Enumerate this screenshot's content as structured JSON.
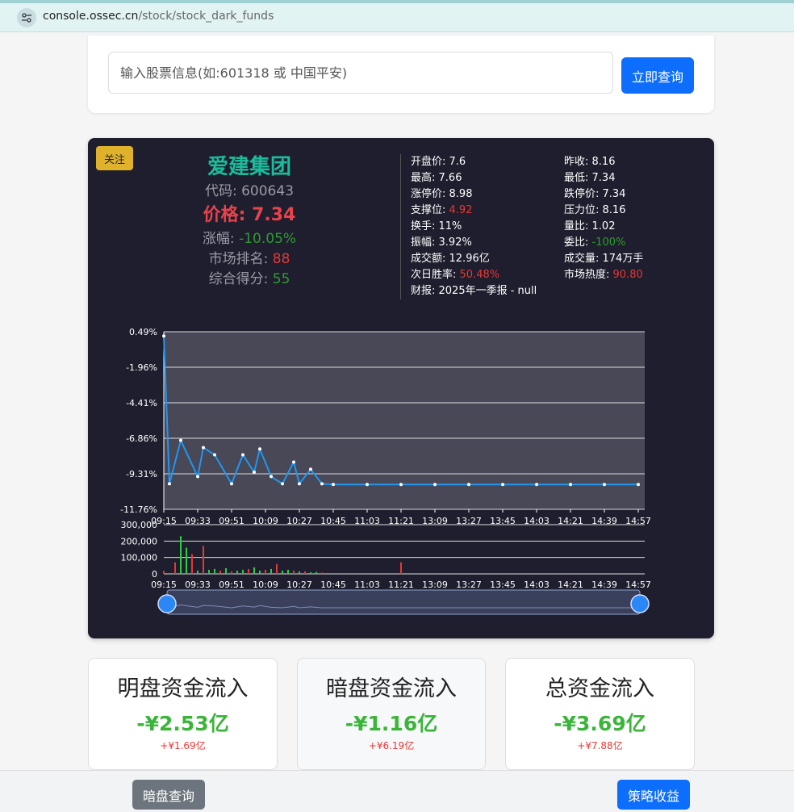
{
  "browser": {
    "url_host": "console.ossec.cn",
    "url_path": "/stock/stock_dark_funds"
  },
  "search": {
    "placeholder": "输入股票信息(如:601318 或 中国平安)",
    "button_label": "立即查询"
  },
  "stock": {
    "follow_label": "关注",
    "name": "爱建集团",
    "code_label": "代码: ",
    "code": "600643",
    "price_label": "价格: ",
    "price": "7.34",
    "change_label": "涨幅: ",
    "change": "-10.05%",
    "rank_label": "市场排名: ",
    "rank": "88",
    "score_label": "综合得分: ",
    "score": "55"
  },
  "stats": {
    "open_label": "开盘价: ",
    "open": "7.6",
    "prev_close_label": "昨收: ",
    "prev_close": "8.16",
    "high_label": "最高: ",
    "high": "7.66",
    "low_label": "最低: ",
    "low": "7.34",
    "limit_up_label": "涨停价: ",
    "limit_up": "8.98",
    "limit_down_label": "跌停价: ",
    "limit_down": "7.34",
    "support_label": "支撑位: ",
    "support": "4.92",
    "resistance_label": "压力位: ",
    "resistance": "8.16",
    "turnover_label": "换手: ",
    "turnover": "11%",
    "volume_ratio_label": "量比: ",
    "volume_ratio": "1.02",
    "amplitude_label": "振幅: ",
    "amplitude": "3.92%",
    "bid_ratio_label": "委比: ",
    "bid_ratio": "-100%",
    "amount_label": "成交额: ",
    "amount": "12.96亿",
    "volume_label": "成交量: ",
    "volume": "174万手",
    "win_rate_label": "次日胜率: ",
    "win_rate": "50.48%",
    "heat_label": "市场热度: ",
    "heat": "90.80",
    "report_label": "财报: ",
    "report": "2025年一季报 - null"
  },
  "chart_data": [
    {
      "type": "line",
      "series": [
        {
          "values": [
            0.2,
            -10.0,
            -7.0,
            -9.5,
            -7.5,
            -8.0,
            -10.0,
            -8.0,
            -9.2,
            -7.6,
            -9.5,
            -10.0,
            -8.5,
            -10.0,
            -9.0,
            -10.0,
            -10.05,
            -10.05,
            -10.05,
            -10.05,
            -10.05,
            -10.05,
            -10.05,
            -10.05,
            -10.05,
            -10.05
          ]
        }
      ],
      "x": [
        "09:15",
        "09:18",
        "09:24",
        "09:33",
        "09:36",
        "09:42",
        "09:51",
        "09:57",
        "10:03",
        "10:06",
        "10:12",
        "10:18",
        "10:24",
        "10:27",
        "10:33",
        "10:39",
        "10:45",
        "11:03",
        "11:21",
        "13:09",
        "13:27",
        "13:45",
        "14:03",
        "14:21",
        "14:39",
        "14:57"
      ],
      "xticks": [
        "09:15",
        "09:33",
        "09:51",
        "10:09",
        "10:27",
        "10:45",
        "11:03",
        "11:21",
        "13:09",
        "13:27",
        "13:45",
        "14:03",
        "14:21",
        "14:39",
        "14:57"
      ],
      "yticks": [
        "0.49%",
        "-1.96%",
        "-4.41%",
        "-6.86%",
        "-9.31%",
        "-11.76%"
      ],
      "ylim": [
        -11.76,
        0.49
      ],
      "grid": true,
      "color": "#2196f3"
    },
    {
      "type": "bar",
      "x": [
        "09:15",
        "09:21",
        "09:24",
        "09:27",
        "09:30",
        "09:33",
        "09:36",
        "09:39",
        "09:42",
        "09:45",
        "09:48",
        "09:51",
        "09:54",
        "09:57",
        "10:00",
        "10:03",
        "10:06",
        "10:09",
        "10:12",
        "10:15",
        "10:18",
        "10:21",
        "10:24",
        "10:27",
        "10:30",
        "10:33",
        "10:36",
        "10:39",
        "11:21"
      ],
      "values": [
        18000,
        70000,
        230000,
        160000,
        120000,
        20000,
        170000,
        25000,
        30000,
        20000,
        35000,
        15000,
        20000,
        25000,
        30000,
        40000,
        20000,
        25000,
        30000,
        60000,
        20000,
        25000,
        20000,
        15000,
        15000,
        10000,
        12000,
        8000,
        70000
      ],
      "colors": [
        "red",
        "red",
        "green",
        "green",
        "red",
        "green",
        "red",
        "green",
        "green",
        "red",
        "green",
        "red",
        "green",
        "green",
        "red",
        "green",
        "green",
        "red",
        "green",
        "red",
        "green",
        "green",
        "red",
        "green",
        "red",
        "green",
        "green",
        "red",
        "red"
      ],
      "xticks": [
        "09:15",
        "09:33",
        "09:51",
        "10:09",
        "10:27",
        "10:45",
        "11:03",
        "11:21",
        "13:09",
        "13:27",
        "13:45",
        "14:03",
        "14:21",
        "14:39",
        "14:57"
      ],
      "yticks": [
        "300,000",
        "200,000",
        "100,000",
        "0"
      ],
      "ylim": [
        0,
        300000
      ]
    }
  ],
  "funds": {
    "visible": {
      "title": "明盘资金流入",
      "value": "-¥2.53亿",
      "sub": "+¥1.69亿"
    },
    "dark": {
      "title": "暗盘资金流入",
      "value": "-¥1.16亿",
      "sub": "+¥6.19亿"
    },
    "total": {
      "title": "总资金流入",
      "value": "-¥3.69亿",
      "sub": "+¥7.88亿"
    }
  },
  "bottom": {
    "dark_query_label": "暗盘查询",
    "strategy_label": "策略收益"
  },
  "colors": {
    "accent": "#0d6efd",
    "up": "#e53935",
    "down": "#2e9d2e",
    "line": "#2196f3",
    "card_bg": "#1e1e2e"
  }
}
